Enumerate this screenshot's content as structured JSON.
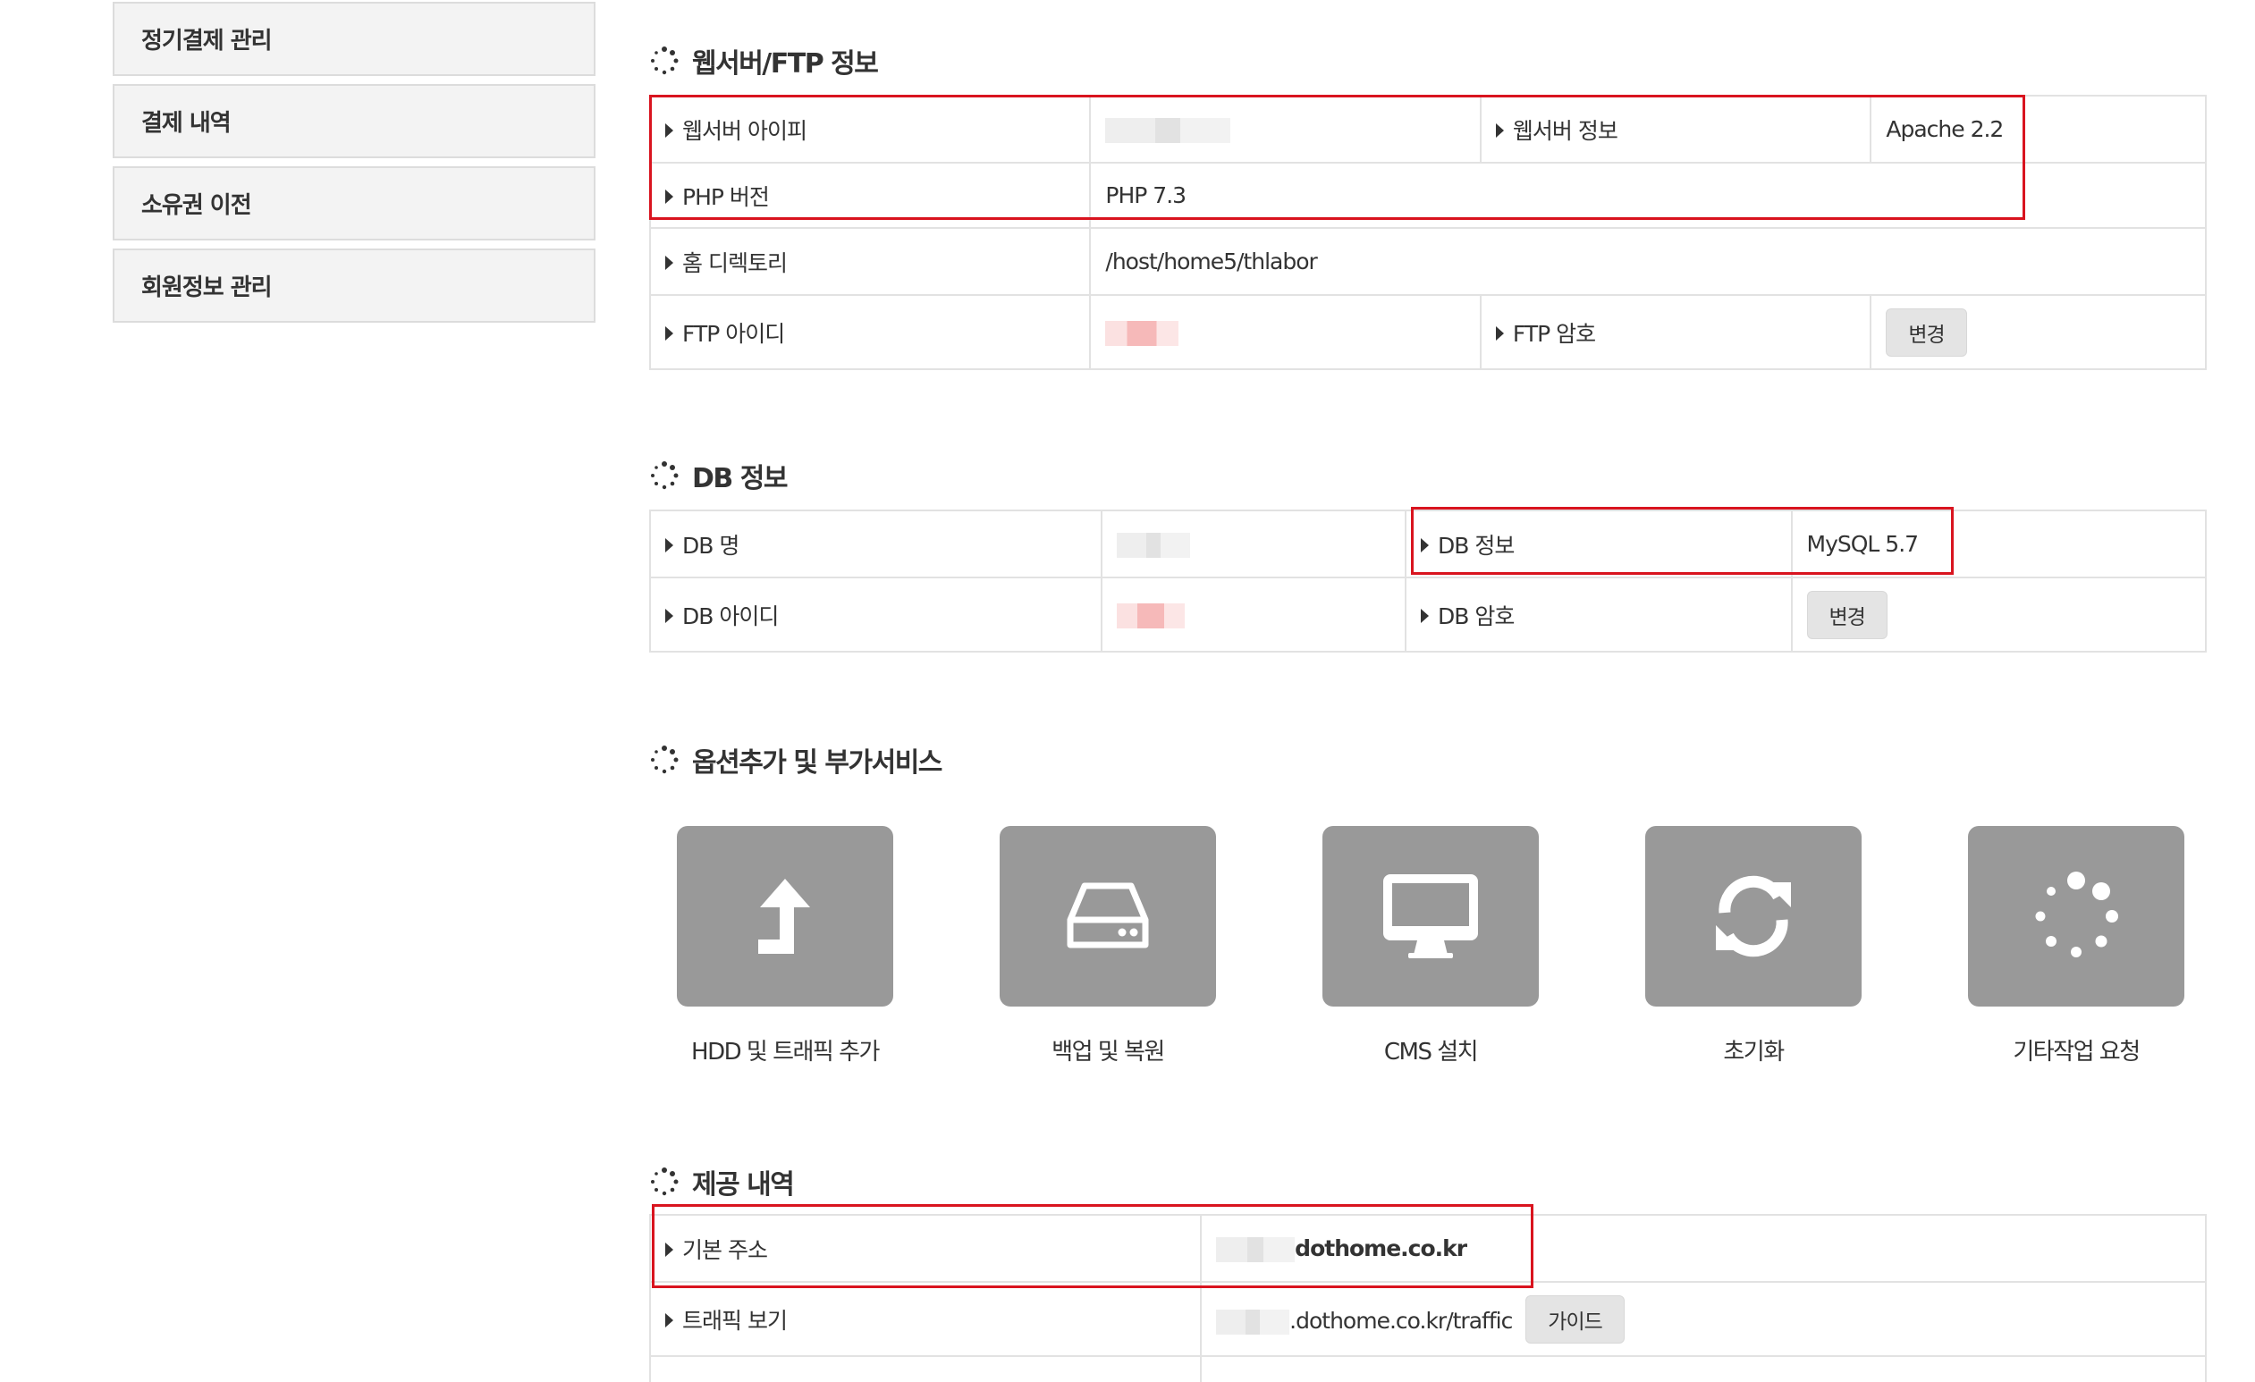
{
  "sidebar": {
    "items": [
      {
        "label": "정기결제 관리"
      },
      {
        "label": "결제 내역"
      },
      {
        "label": "소유권 이전"
      },
      {
        "label": "회원정보 관리"
      }
    ]
  },
  "web": {
    "title": "웹서버/FTP 정보",
    "ip_label": "웹서버 아이피",
    "server_info_label": "웹서버 정보",
    "server_info_value": "Apache 2.2",
    "php_label": "PHP 버전",
    "php_value": "PHP 7.3",
    "home_label": "홈 디렉토리",
    "home_value": "/host/home5/thlabor",
    "ftp_id_label": "FTP 아이디",
    "ftp_pw_label": "FTP 암호",
    "ftp_pw_button": "변경"
  },
  "db": {
    "title": "DB 정보",
    "name_label": "DB 명",
    "info_label": "DB 정보",
    "info_value": "MySQL 5.7",
    "id_label": "DB 아이디",
    "pw_label": "DB 암호",
    "pw_button": "변경"
  },
  "services": {
    "title": "옵션추가 및 부가서비스",
    "items": [
      {
        "label": "HDD 및 트래픽 추가",
        "icon": "upload-arrow-icon"
      },
      {
        "label": "백업 및 복원",
        "icon": "hard-drive-icon"
      },
      {
        "label": "CMS 설치",
        "icon": "monitor-icon"
      },
      {
        "label": "초기화",
        "icon": "refresh-icon"
      },
      {
        "label": "기타작업 요청",
        "icon": "spinner-icon"
      }
    ]
  },
  "provided": {
    "title": "제공 내역",
    "address_label": "기본 주소",
    "address_value": "dothome.co.kr",
    "traffic_label": "트래픽 보기",
    "traffic_value": ".dothome.co.kr/traffic",
    "traffic_button": "가이드"
  },
  "colors": {
    "accent_red": "#d9141f",
    "tile_gray": "#999999",
    "value_red": "#e01b1b"
  }
}
